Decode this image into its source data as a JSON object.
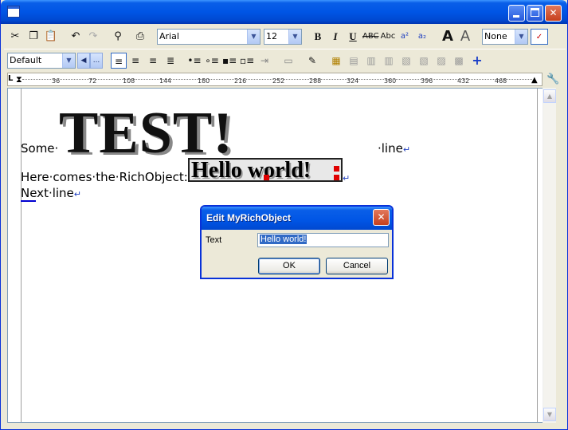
{
  "window": {
    "title": ""
  },
  "toolbar1": {
    "font_name": "Arial",
    "font_size": "12",
    "bold": "B",
    "italic": "I",
    "underline": "U",
    "strike": "ABC",
    "smallcaps": "Abc",
    "superscript": "a²",
    "subscript": "a₂",
    "style_select": "None"
  },
  "toolbar2": {
    "paragraph_style": "Default",
    "more_button": "..."
  },
  "ruler": {
    "ticks": [
      "36",
      "72",
      "108",
      "144",
      "180",
      "216",
      "252",
      "288",
      "324",
      "360",
      "396",
      "432",
      "468"
    ]
  },
  "document": {
    "big_text": "TEST!",
    "line1_start": "Some·",
    "line1_end": "·line",
    "line2": "Here·comes·the·RichObject:·",
    "rich_object_text": "Hello world!",
    "line3": "Next·line",
    "para_mark": "↵"
  },
  "dialog": {
    "title": "Edit MyRichObject",
    "label": "Text",
    "value": "Hello world!",
    "ok": "OK",
    "cancel": "Cancel",
    "close": "✕"
  },
  "colors": {
    "titlebar": "#0055e5",
    "selection": "#316ac5",
    "handle": "#e00000"
  }
}
